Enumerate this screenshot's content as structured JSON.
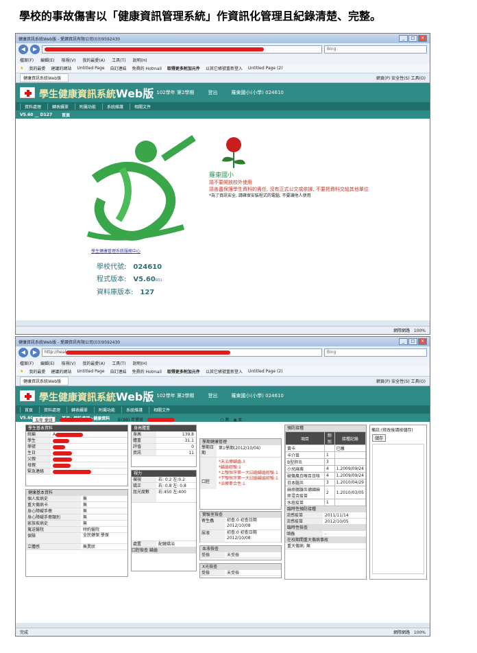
{
  "doc": {
    "title": "學校的事故傷害以「健康資訊管理系統」作資訊化管理且紀錄清楚、完整。"
  },
  "browser1": {
    "window_title": "健康資訊系統Web版 - 愛讀資訊有限公司(03)9592430",
    "url": "",
    "search_placeholder": "Bing",
    "menu": [
      "檔案(F)",
      "編輯(E)",
      "檢視(V)",
      "我的最愛(A)",
      "工具(T)",
      "說明(H)"
    ],
    "favorites": [
      "我的最愛",
      "建議的網站",
      "Untitled Page",
      "自訂連結",
      "免費的 Hotmail",
      "取得更多附加元件",
      "以其它帳號重新登入",
      "Untitled Page (2)"
    ],
    "tab": "健康資訊系統Web版",
    "tools": [
      "網頁(P)",
      "安全性(S)",
      "工具(O)"
    ],
    "status_zone": "網際網路",
    "zoom": "100%"
  },
  "app1": {
    "title_main": "學生健康資訊系統",
    "title_web": "Web版",
    "semester": "102學年 第2學期",
    "logout": "登出",
    "school": "羅東國小(小學) 024610",
    "nav": [
      "資料處理",
      "轉表續單",
      "附屬功能",
      "系統維護",
      "相關文件"
    ],
    "version_prefix": "V5.60 __ D127",
    "home": "首頁",
    "school_name": "羅東國小",
    "warn1": "請不要開放校外使用",
    "warn2": "請善盡保護學生資料的責任, 沒有正式公文或依據, 不要把資料交給其他單位",
    "note": "*為了資訊安全, 請確保安裝程式的電腦, 不要讓他人使用",
    "service_link": "學生健康管理系統服務中心",
    "code_label": "學校代號:",
    "code_value": "024610",
    "prog_label": "程式版本:",
    "prog_value": "V5.60",
    "prog_sub": "R01",
    "db_label": "資料庫版本:",
    "db_value": "127"
  },
  "browser2": {
    "window_title": "健康資訊系統Web版 - 愛讀資訊有限公司(03)9592430",
    "url": "http://heal",
    "search_placeholder": "Bing",
    "tab": "健康資訊系統Web版",
    "status_left": "完成",
    "status_zone": "網際網路",
    "zoom": "100%"
  },
  "app2": {
    "title_main": "學生健康資訊系統",
    "title_web": "Web版",
    "semester": "102學年 第2學期",
    "logout": "登出",
    "school": "羅東國小(小學) 024610",
    "nav": [
      "首頁",
      "資料處理",
      "轉表續單",
      "附屬功能",
      "系統維護",
      "相關文件"
    ],
    "version": "V5.60 __ D127",
    "breadcrumb": "首頁>資料處理>健康資料",
    "grade_sel": "五年 愛班",
    "student_hdr": "五(98) 年愛班",
    "gender_m": "男",
    "gender_f": "女",
    "basic": {
      "header": "學生基本資料",
      "rows": [
        {
          "k": "統編",
          "v": "A"
        },
        {
          "k": "學生",
          "v": ""
        },
        {
          "k": "學號",
          "v": ""
        },
        {
          "k": "生日",
          "v": ""
        },
        {
          "k": "父親",
          "v": ""
        },
        {
          "k": "母親",
          "v": ""
        },
        {
          "k": "緊急連絡",
          "v": ""
        }
      ]
    },
    "health_basic": {
      "header": "健康基本資料",
      "rows": [
        {
          "k": "個人疾病史",
          "v": "無"
        },
        {
          "k": "重大傷病卡",
          "v": "無"
        },
        {
          "k": "身心障礙手冊",
          "v": "無"
        },
        {
          "k": "身心障礙手冊類別",
          "v": "無"
        },
        {
          "k": "家族疾病史",
          "v": "無"
        },
        {
          "k": "蒐送醫院",
          "v": "特約醫院"
        },
        {
          "k": "保險",
          "v": "全民健保 學保"
        },
        {
          "k": "立體感",
          "v": "無異狀"
        }
      ]
    },
    "body": {
      "header": "身高體重",
      "rows": [
        {
          "k": "身高",
          "v": "139.8"
        },
        {
          "k": "體重",
          "v": "31.1"
        },
        {
          "k": "評值",
          "v": "0"
        },
        {
          "k": "資訊",
          "v": "11"
        }
      ]
    },
    "vision": {
      "header": "視力",
      "rows": [
        {
          "k": "裸視",
          "v": "右: 0.2 左:0.2"
        },
        {
          "k": "矯正",
          "v": "右: 0.8 左: 0.8"
        },
        {
          "k": "屈光度數",
          "v": "右:450 左:400"
        },
        {
          "k": "處置",
          "v": "配鏡矯治"
        }
      ],
      "footer1": "口腔檢查",
      "footer2": "齲齒"
    },
    "mgmt": {
      "header": "學期健康管理",
      "col_title": "學期日期",
      "col_value": "第1學期(2012/10/04)",
      "lines": [
        "*未治療齲齒:3",
        "*齲齒經驗:1",
        "*上顎恒牙第一大臼齒齲齒經驗:1",
        "*下顎恒牙第一大臼齒齲齒經驗:1",
        "*治療牽合性:1"
      ],
      "row_label": "口腔"
    },
    "lab": {
      "header": "實驗室檢查",
      "rows": [
        {
          "k": "寄生蟲",
          "v": "初查:0 初查日期 2012/10/08"
        },
        {
          "k": "尿液",
          "v": "初查:0 初查日期 2012/10/08"
        }
      ]
    },
    "blood": {
      "header": "血液檢查",
      "k": "受檢",
      "v": "未受檢"
    },
    "xray": {
      "header": "X光檢查",
      "k": "受檢",
      "v": "未受檢"
    },
    "vaccine": {
      "header": "預防接種",
      "cols": [
        "項目",
        "劑別",
        "接種記錄"
      ],
      "rows": [
        [
          "黃卡",
          "",
          "已繳"
        ],
        [
          "卡介苗",
          "1",
          ""
        ],
        [
          "B型肝炎",
          "3",
          ""
        ],
        [
          "小兒麻痺",
          "4",
          "1.2009/09/24"
        ],
        [
          "破傷風白喉百日咳",
          "4",
          "1.2009/09/24"
        ],
        [
          "日本腦炎",
          "3",
          "1.2010/04/29"
        ],
        [
          "麻疹腮腺炎德國麻疹混合疫苗",
          "2",
          "1.2010/03/05"
        ],
        [
          "水痘疫苗",
          "1",
          ""
        ]
      ],
      "temp_header": "臨時性預防接種",
      "temp_rows": [
        [
          "流感疫苗",
          "2011/11/14"
        ],
        [
          "流感疫苗",
          "2012/10/05"
        ]
      ],
      "check_header": "臨時性檢查",
      "check_rows": [
        [
          "頭蝨",
          "-"
        ]
      ],
      "accident_header": "在校期間重大傷病事故",
      "accident_row": "重大傷病: 無"
    },
    "remark": {
      "label": "備註:(修改後請按儲存)",
      "save": "儲存"
    }
  }
}
